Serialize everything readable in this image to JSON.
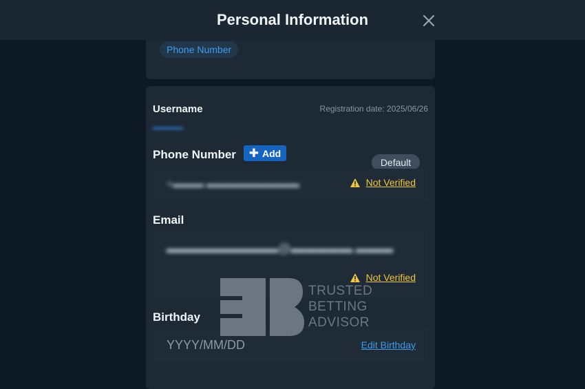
{
  "header": {
    "title": "Personal Information",
    "close_icon": "close-icon"
  },
  "top_card": {
    "chip_label": "Phone Number"
  },
  "account": {
    "username_label": "Username",
    "username_value": "",
    "registration_date": "Registration date: 2025/06/26"
  },
  "phone": {
    "label": "Phone Number",
    "add_button": "Add",
    "default_badge": "Default",
    "value": "",
    "status": "Not Verified",
    "status_icon": "warning-icon"
  },
  "email": {
    "label": "Email",
    "value": "",
    "status": "Not Verified",
    "status_icon": "warning-icon"
  },
  "birthday": {
    "label": "Birthday",
    "placeholder": "YYYY/MM/DD",
    "edit_link": "Edit Birthday"
  },
  "watermark": {
    "line1": "TRUSTED",
    "line2": "BETTING",
    "line3": "ADVISOR"
  },
  "colors": {
    "accent": "#1565c0",
    "link": "#3a9de8",
    "warning": "#f0c63c",
    "background": "#0d1a26"
  }
}
